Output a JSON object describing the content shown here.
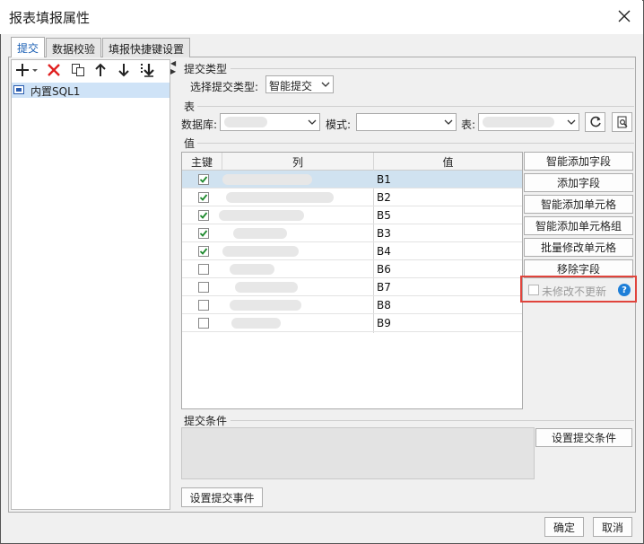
{
  "window": {
    "title": "报表填报属性"
  },
  "tabs": [
    {
      "label": "提交"
    },
    {
      "label": "数据校验"
    },
    {
      "label": "填报快捷键设置"
    }
  ],
  "left_pane": {
    "toolbar_icons": [
      "add-dropdown-icon",
      "delete-icon",
      "copy-icon",
      "move-up-icon",
      "move-down-icon",
      "move-bottom-icon"
    ],
    "items": [
      {
        "label": "内置SQL1",
        "icon": "database-icon",
        "selected": true
      }
    ]
  },
  "submit_type": {
    "section_label": "提交类型",
    "field_label": "选择提交类型:",
    "value": "智能提交"
  },
  "table_section": {
    "section_label": "表",
    "db_label": "数据库:",
    "schema_label": "模式:",
    "table_label": "表:"
  },
  "value_section": {
    "section_label": "值",
    "columns": [
      "主键",
      "列",
      "值"
    ],
    "rows": [
      {
        "key": true,
        "value": "B1",
        "selected": true
      },
      {
        "key": true,
        "value": "B2",
        "selected": false
      },
      {
        "key": true,
        "value": "B5",
        "selected": false
      },
      {
        "key": true,
        "value": "B3",
        "selected": false
      },
      {
        "key": true,
        "value": "B4",
        "selected": false
      },
      {
        "key": false,
        "value": "B6",
        "selected": false
      },
      {
        "key": false,
        "value": "B7",
        "selected": false
      },
      {
        "key": false,
        "value": "B8",
        "selected": false
      },
      {
        "key": false,
        "value": "B9",
        "selected": false
      }
    ]
  },
  "side_buttons": {
    "smart_add_field": "智能添加字段",
    "add_field": "添加字段",
    "smart_add_cell": "智能添加单元格",
    "smart_add_cell_group": "智能添加单元格组",
    "batch_modify_cell": "批量修改单元格",
    "remove_field": "移除字段",
    "no_update_unmodified": "未修改不更新"
  },
  "submit_condition": {
    "section_label": "提交条件",
    "button": "设置提交条件"
  },
  "submit_event_button": "设置提交事件",
  "footer": {
    "ok": "确定",
    "cancel": "取消"
  },
  "colors": {
    "highlight": "#e0443c",
    "selection": "#d0e2f0",
    "accent": "#1a5fb4",
    "help": "#1e7fd8"
  }
}
